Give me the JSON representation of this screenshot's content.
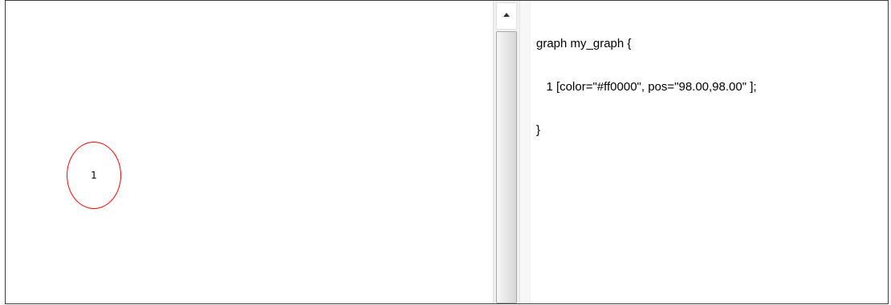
{
  "graph_canvas": {
    "node": {
      "label": "1",
      "color": "#ff0000"
    }
  },
  "code_editor": {
    "lines": [
      "graph my_graph {",
      "   1 [color=\"#ff0000\", pos=\"98.00,98.00\" ];",
      "}"
    ]
  },
  "scrollbar": {
    "up_icon": "scroll-up-arrow-icon"
  }
}
